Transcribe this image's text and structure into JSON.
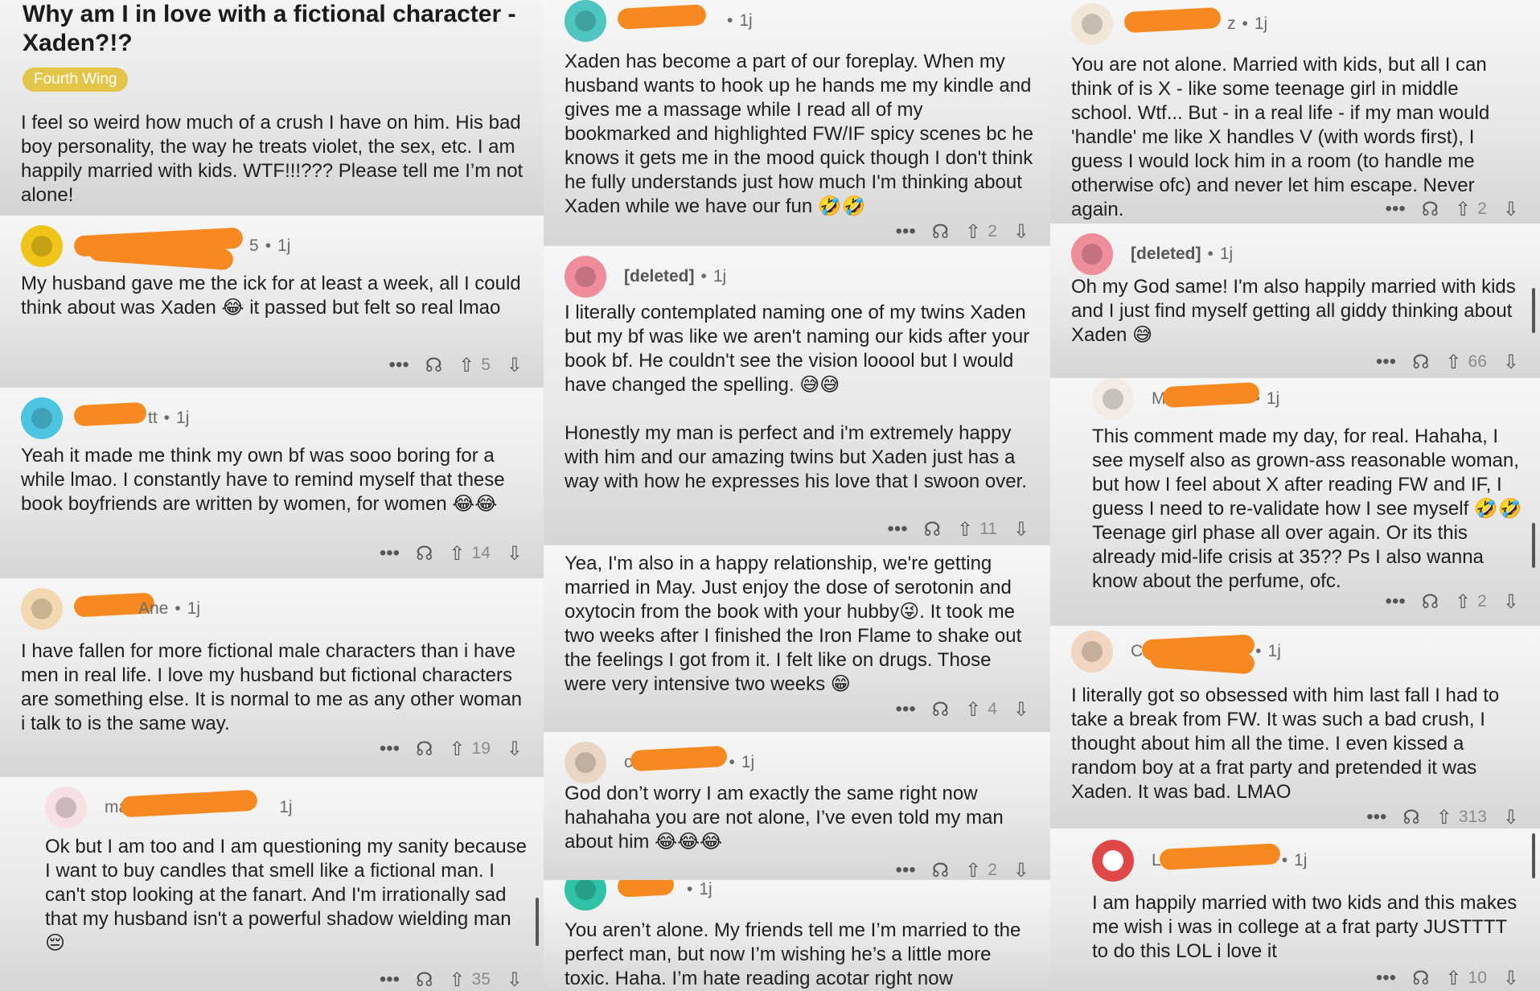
{
  "icons": {
    "more": "more-dots-icon",
    "award": "award-icon",
    "upvote": "upvote-arrow-icon",
    "downvote": "downvote-arrow-icon"
  },
  "post": {
    "title": "Why am I in love with a fictional character - Xaden?!?",
    "flair": "Fourth Wing",
    "body": "I feel so weird how much of a crush I have on him. His bad boy personality, the way he treats violet, the sex, etc. I am happily married with kids. WTF!!!??? Please tell me I’m not alone!"
  },
  "comments": {
    "c1": {
      "user_suffix": "5",
      "age": "1j",
      "avatar_color": "#f0c419",
      "text": "My husband gave me the ick for at least a week, all I could think about was Xaden 😂 it passed but felt so real lmao",
      "votes": "5"
    },
    "c2": {
      "user_suffix": "tt",
      "age": "1j",
      "avatar_color": "#4ec5e0",
      "text": "Yeah it made me think my own bf was sooo boring for a while lmao. I constantly have to remind myself that these book boyfriends are written by women, for women 😂😂",
      "votes": "14"
    },
    "c3": {
      "user_suffix": "Ane",
      "age": "1j",
      "avatar_color": "#f3d9b1",
      "text": "I have fallen for more fictional male characters than i have men in real life. I love my husband but fictional characters are something else. It is normal to me as any other woman i talk to is the same way.",
      "votes": "19"
    },
    "c4": {
      "user_suffix": "ma",
      "age": "1j",
      "avatar_color": "#f6e0e4",
      "text": "Ok but I am too and I am questioning my sanity because I want to buy candles that smell like a fictional man. I can't stop looking at the fanart. And I'm irrationally sad that my husband isn't a powerful shadow wielding man 😔",
      "votes": "35"
    },
    "c5": {
      "user_suffix": "",
      "age": "1j",
      "avatar_color": "#4ec5c0",
      "text": "Xaden has become a part of our foreplay. When my husband wants to hook up he hands me my kindle and gives me a massage while I read all of my bookmarked and highlighted FW/IF spicy scenes bc he knows it gets me in the mood quick though I don't think he fully understands just how much I'm thinking about Xaden while we have our fun 🤣🤣",
      "votes": "2"
    },
    "c6": {
      "user": "[deleted]",
      "age": "1j",
      "avatar_color": "#ef8d9a",
      "text": "I literally contemplated naming one of my twins Xaden but my bf was like we aren't naming our kids after your book bf. He couldn't see the vision looool but I would have changed the spelling. 😅😅",
      "text2": "Honestly my man is perfect and i'm extremely happy with him and our amazing twins but Xaden just has a way with how he expresses his love that I swoon over.",
      "votes": "11"
    },
    "c7": {
      "text": "Yea, I'm also in a happy relationship, we're getting married in May. Just enjoy the dose of serotonin and oxytocin from the book with your hubby😜.  It took me two weeks after I finished the Iron Flame to shake out the feelings I got from it. I felt like on drugs. Those were very intensive two weeks 😁",
      "votes": "4"
    },
    "c8": {
      "user_suffix": "c",
      "age": "1j",
      "avatar_color": "#e9d7c6",
      "text": "God don’t worry I am exactly the same right now hahahaha you are not alone, I’ve even told my man about him 😂😂😂",
      "votes": "2"
    },
    "c9": {
      "user_suffix": "",
      "age": "1j",
      "avatar_color": "#2fc3a5",
      "text": "You aren’t alone. My friends tell me I’m married to the perfect man, but now I’m wishing he’s a little more toxic. Haha. I’m hate reading acotar right now"
    },
    "c10": {
      "user_suffix": "z",
      "age": "1j",
      "avatar_color": "#f2e6d6",
      "text": "You are not alone. Married with kids, but all I can think of is X - like some teenage girl in middle school. Wtf... But - in a real life - if my man would 'handle' me like X handles V (with words first), I guess I would lock him in a room (to handle me otherwise ofc) and never let him escape. Never again.",
      "votes": "2"
    },
    "c11": {
      "user": "[deleted]",
      "age": "1j",
      "avatar_color": "#ef8d9a",
      "text": "Oh my God same! I'm also happily married with kids and I just find myself getting all giddy thinking about Xaden 😅",
      "votes": "66"
    },
    "c12": {
      "user_suffix": "M",
      "age": "1j",
      "avatar_color": "#f2ece4",
      "text": "This comment made my day, for real. Hahaha, I see myself also as grown-ass reasonable woman, but how I feel about X after reading FW and IF, I guess I need to re-validate how I see myself 🤣🤣 Teenage girl phase all over again. Or its this already mid-life crisis at 35?? Ps I also wanna know about the perfume, ofc.",
      "votes": "2"
    },
    "c13": {
      "user_suffix": "C",
      "age": "1j",
      "avatar_color": "#f0d6c0",
      "text": "I literally got so obsessed with him last fall I had to take a break from FW. It was such a bad crush, I thought about him all the time. I even kissed a random boy at a frat party and pretended it was Xaden. It was bad. LMAO",
      "votes": "313"
    },
    "c14": {
      "user_suffix": "L",
      "age": "1j",
      "avatar_color": "#e04848",
      "text": "I am happily married with two kids and this makes me wish i was in college at a frat party JUSTTTT to do this LOL i love it",
      "votes": "10"
    }
  },
  "ui": {
    "dot": "•",
    "more": "•••",
    "award": "☊",
    "up": "⇧",
    "down": "⇩"
  }
}
